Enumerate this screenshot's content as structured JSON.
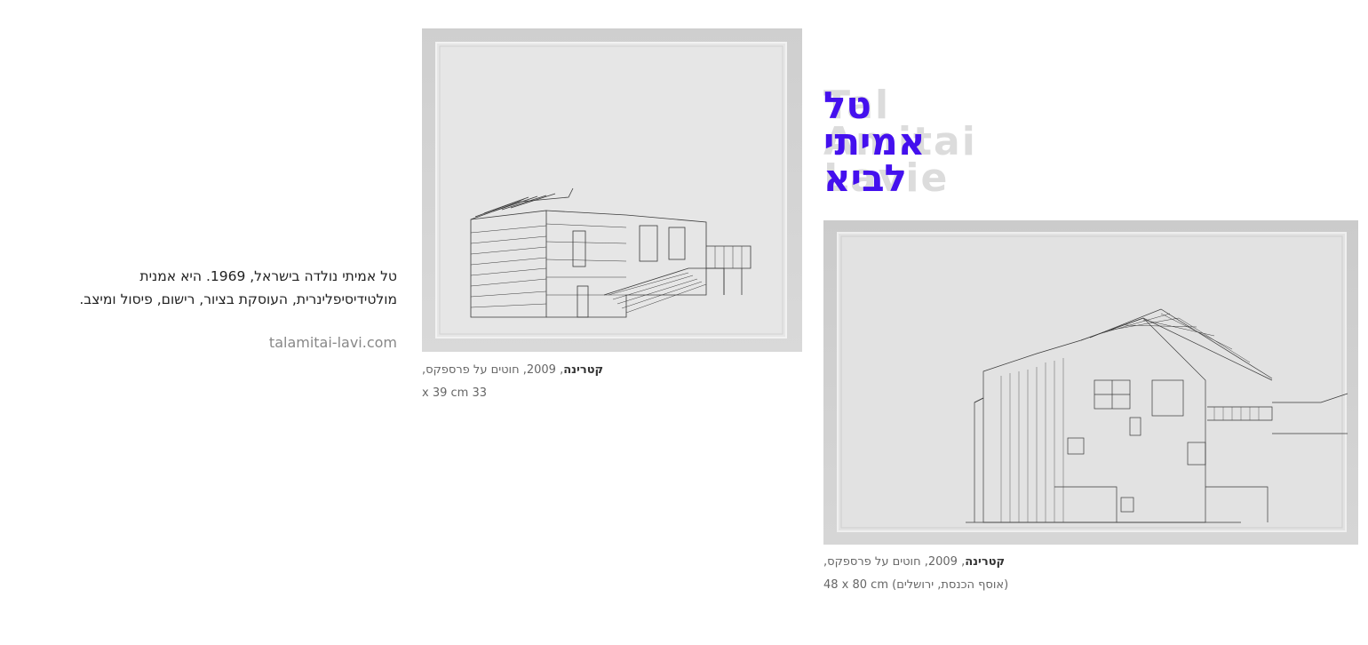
{
  "title": {
    "hebrew_lines": [
      "טל",
      "אמיתי",
      "לביא"
    ],
    "english_lines": [
      "Tal",
      "Amitai",
      "Lavie"
    ]
  },
  "bio": {
    "line1": "טל אמיתי נולדה בישראל, 1969. היא אמנית",
    "line2": "מולטידיסיפלינרית, העוסקת בציור, רישום, פיסול ומיצב.",
    "link": "talamitai-lavi.com"
  },
  "artworks": [
    {
      "title": "קטרינה",
      "details": ", 2009, חוטים על פרספקס,",
      "size": "x 39 cm 33"
    },
    {
      "title": "קטרינה",
      "details": ", 2009, חוטים על פרספקס,",
      "size": "48 x 80 cm (אוסף הכנסת, ירושלים)"
    }
  ],
  "colors": {
    "accent": "#4410ee",
    "ghost_text": "#dcdcdc",
    "caption": "#666666"
  }
}
